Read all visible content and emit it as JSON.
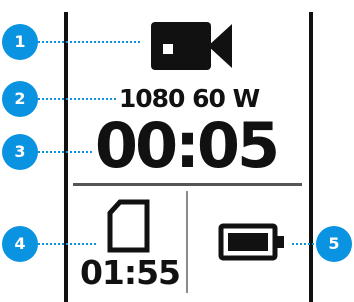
{
  "device_screen": {
    "mode_label": "1080 60 W",
    "timer": "00:05",
    "remaining_time": "01:55"
  },
  "icons": {
    "video": "video-camera-icon",
    "card": "sd-card-icon",
    "battery": "battery-icon"
  },
  "callouts": [
    {
      "number": "1"
    },
    {
      "number": "2"
    },
    {
      "number": "3"
    },
    {
      "number": "4"
    },
    {
      "number": "5"
    }
  ],
  "colors": {
    "callout": "#0a93e0",
    "ink": "#111111",
    "background": "#ffffff"
  }
}
